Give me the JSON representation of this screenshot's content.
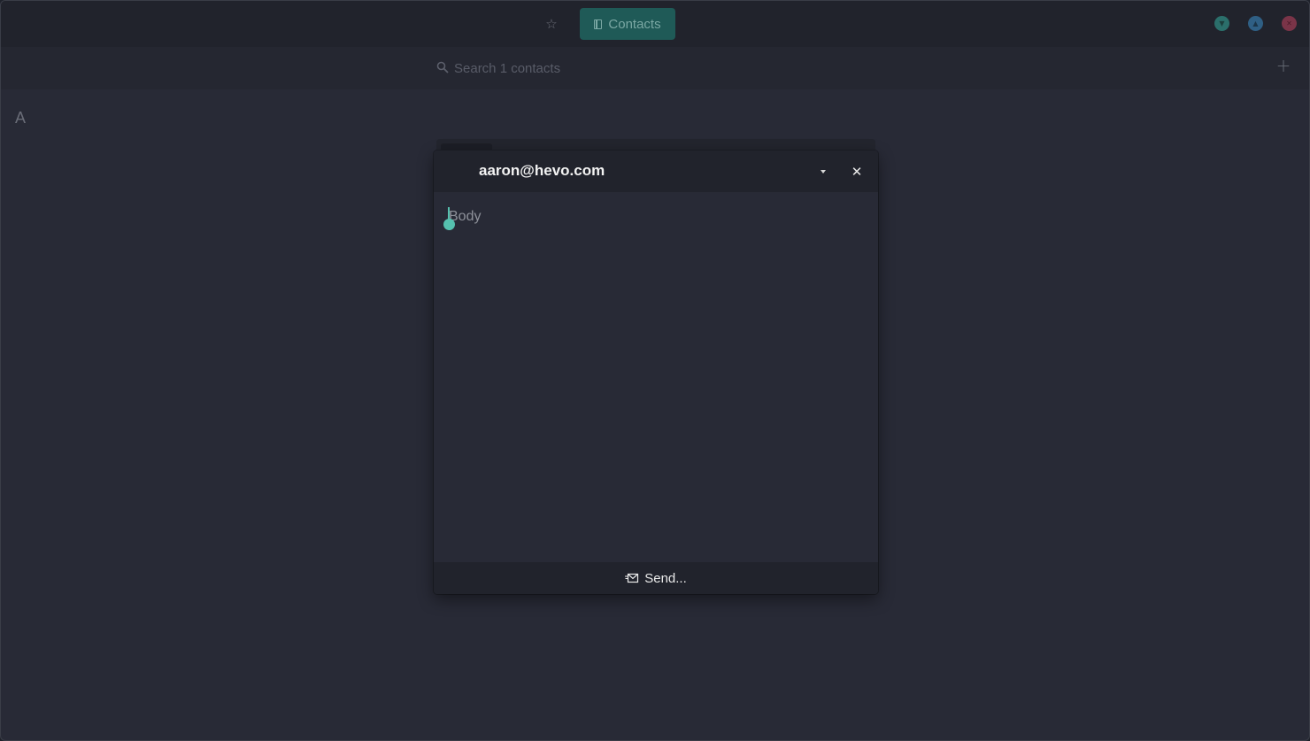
{
  "header": {
    "tab_label": "Contacts",
    "star_icon": "star-icon",
    "window_buttons": [
      "minimize",
      "maximize",
      "close"
    ]
  },
  "search": {
    "placeholder": "Search 1 contacts",
    "value": ""
  },
  "add_label": "+",
  "section_letter": "A",
  "dialog": {
    "title": "aaron@hevo.com",
    "body_placeholder": "Body",
    "send_label": "Send..."
  },
  "colors": {
    "accent": "#55c0ae",
    "tab_active": "#1f5a57",
    "background": "#282a36"
  }
}
